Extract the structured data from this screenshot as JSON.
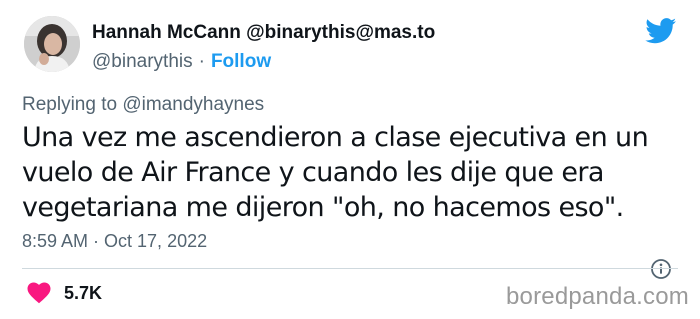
{
  "author": {
    "display_name": "Hannah McCann @binarythis@mas.to",
    "handle": "@binarythis",
    "separator": "·",
    "follow_label": "Follow"
  },
  "reply": {
    "prefix": "Replying to ",
    "mention": "@imandyhaynes"
  },
  "tweet": {
    "text": "Una vez me ascendieron a clase ejecutiva en un vuelo de Air France y cuando les dije que era vegetariana me dijeron \"oh, no hacemos eso\".",
    "timestamp": "8:59 AM · Oct 17, 2022"
  },
  "engagement": {
    "likes": "5.7K"
  },
  "watermark": "boredpanda.com",
  "icons": {
    "logo": "twitter-bird-icon",
    "info": "info-icon",
    "like": "heart-icon"
  },
  "colors": {
    "accent": "#1d9bf0",
    "heart": "#f91880",
    "secondary_text": "#536471",
    "primary_text": "#0f1419"
  }
}
